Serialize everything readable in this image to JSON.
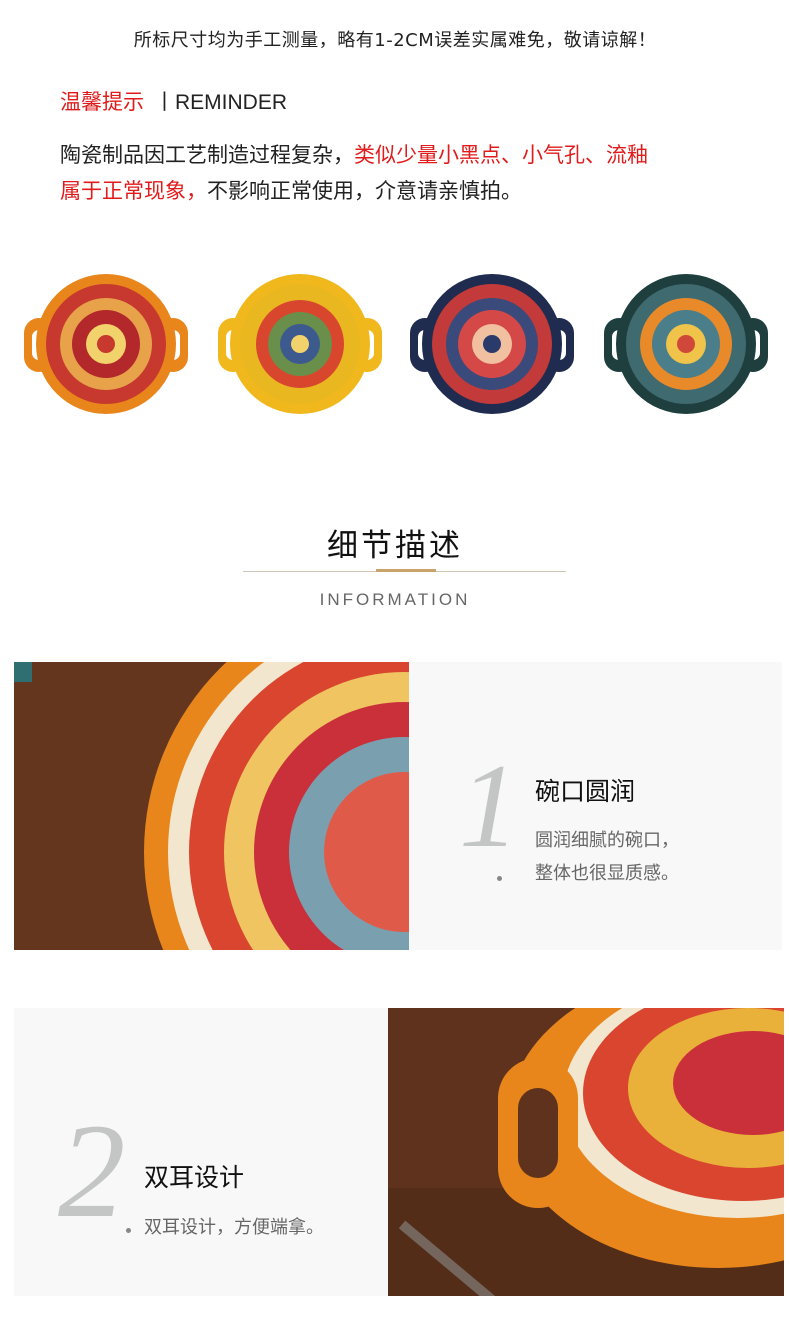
{
  "notice": {
    "measure_note": "所标尺寸均为手工测量，略有1-2CM误差实属难免，敬请谅解！",
    "reminder_title": "温馨提示",
    "reminder_sep": "丨",
    "reminder_en": "REMINDER",
    "line1_black": "陶瓷制品因工艺制造过程复杂，",
    "line1_red": "类似少量小黑点、小气孔、流釉",
    "line2_red": "属于正常现象，",
    "line2_black": "不影响正常使用，介意请亲慎拍。"
  },
  "bowls": [
    {
      "name": "orange",
      "rim": "#e8861c",
      "inner": "#c7392e",
      "accent": "#f2d36b"
    },
    {
      "name": "yellow",
      "rim": "#f0b81c",
      "inner": "#e9b820",
      "accent": "#6a8f4a"
    },
    {
      "name": "navy",
      "rim": "#1f2b4f",
      "inner": "#c23a3a",
      "accent": "#f0c0a0"
    },
    {
      "name": "teal",
      "rim": "#1f3f3f",
      "inner": "#3f6a6f",
      "accent": "#e98a2a"
    }
  ],
  "section": {
    "title": "细节描述",
    "subtitle": "INFORMATION"
  },
  "details": [
    {
      "number": "1",
      "title": "碗口圆润",
      "desc_line1": "圆润细腻的碗口，",
      "desc_line2": "整体也很显质感。"
    },
    {
      "number": "2",
      "title": "双耳设计",
      "desc_line1": "双耳设计，方便端拿。"
    }
  ],
  "colors": {
    "accent_red": "#e11b1b",
    "gold": "#c8a46a",
    "panel_bg": "#f7f8f7",
    "wood": "#6b3b22"
  }
}
